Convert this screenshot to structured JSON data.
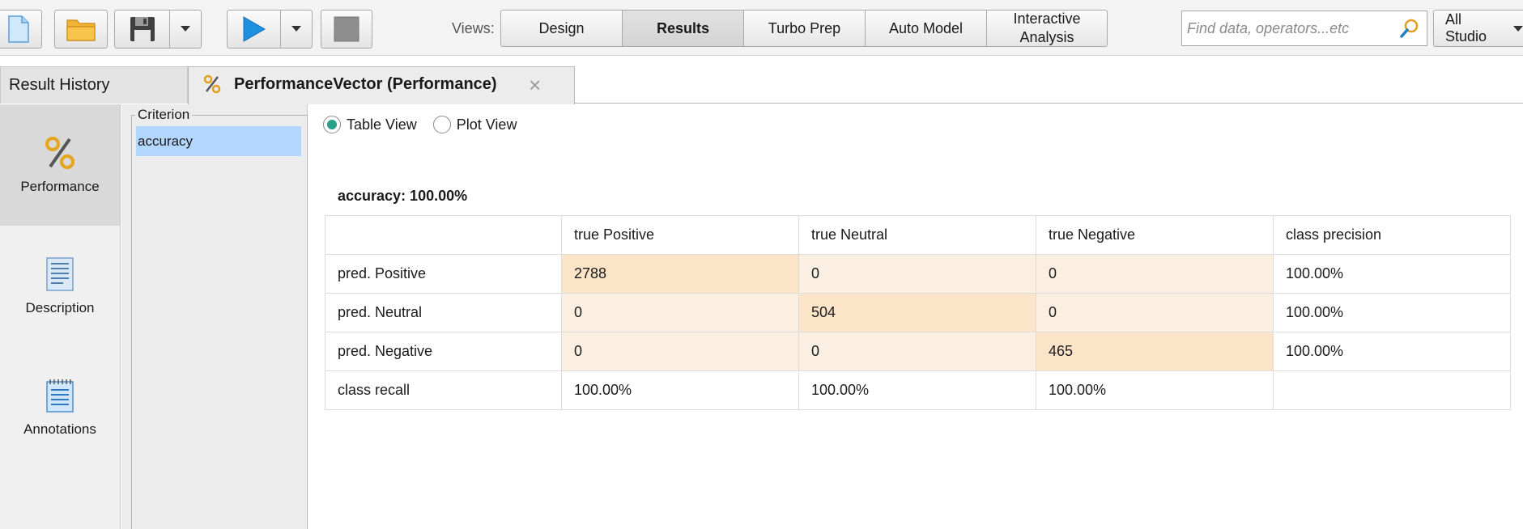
{
  "toolbar": {
    "views_label": "Views:",
    "views": [
      {
        "label": "Design",
        "active": false
      },
      {
        "label": "Results",
        "active": true
      },
      {
        "label": "Turbo Prep",
        "active": false
      },
      {
        "label": "Auto Model",
        "active": false
      },
      {
        "label": "Interactive\nAnalysis",
        "active": false
      }
    ],
    "search_placeholder": "Find data, operators...etc",
    "studio_label": "All Studio"
  },
  "tabs": {
    "history_label": "Result History",
    "active_label": "PerformanceVector (Performance)",
    "close_glyph": "×"
  },
  "leftnav": {
    "items": [
      {
        "label": "Performance",
        "icon": "percent-icon",
        "active": true
      },
      {
        "label": "Description",
        "icon": "document-icon",
        "active": false
      },
      {
        "label": "Annotations",
        "icon": "notepad-icon",
        "active": false
      }
    ]
  },
  "criterion": {
    "legend": "Criterion",
    "items": [
      "accuracy"
    ]
  },
  "main": {
    "view_options": [
      {
        "label": "Table View",
        "checked": true
      },
      {
        "label": "Plot View",
        "checked": false
      }
    ],
    "accuracy_title": "accuracy: 100.00%",
    "table": {
      "headers": [
        "",
        "true Positive",
        "true Neutral",
        "true Negative",
        "class precision"
      ],
      "rows": [
        [
          "pred. Positive",
          "2788",
          "0",
          "0",
          "100.00%"
        ],
        [
          "pred. Neutral",
          "0",
          "504",
          "0",
          "100.00%"
        ],
        [
          "pred. Negative",
          "0",
          "0",
          "465",
          "100.00%"
        ],
        [
          "class recall",
          "100.00%",
          "100.00%",
          "100.00%",
          ""
        ]
      ]
    }
  }
}
